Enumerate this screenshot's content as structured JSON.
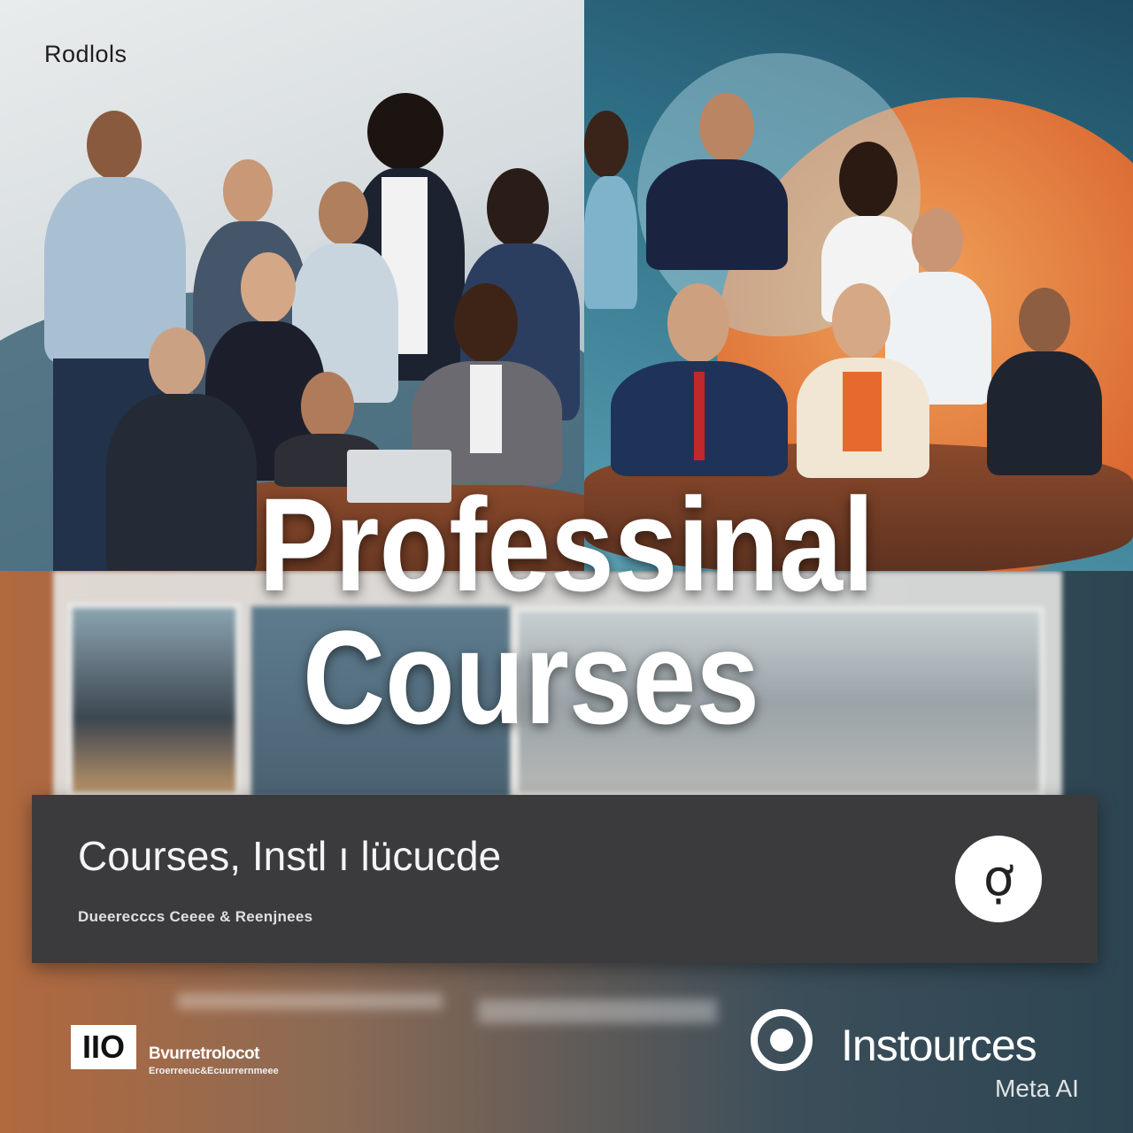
{
  "top_label": "Rodlols",
  "title": {
    "line1": "Professinal",
    "line2": "Courses"
  },
  "banner": {
    "title": "Courses, Instl ı lücucde",
    "subtitle": "Dueerecccs Ceeee & Reenjnees",
    "logo_glyph": "ợ"
  },
  "footer": {
    "badge": "IIO",
    "org": "Bvurretrolocot",
    "org_sub": "Eroerreeuc&Ecuurrernmeee",
    "brand": "Instources"
  },
  "watermark": "Meta AI",
  "colors": {
    "banner_bg": "#3b3b3e",
    "title_text": "#ffffff",
    "accent_orange": "#d9652f",
    "accent_teal": "#2f6f86"
  }
}
